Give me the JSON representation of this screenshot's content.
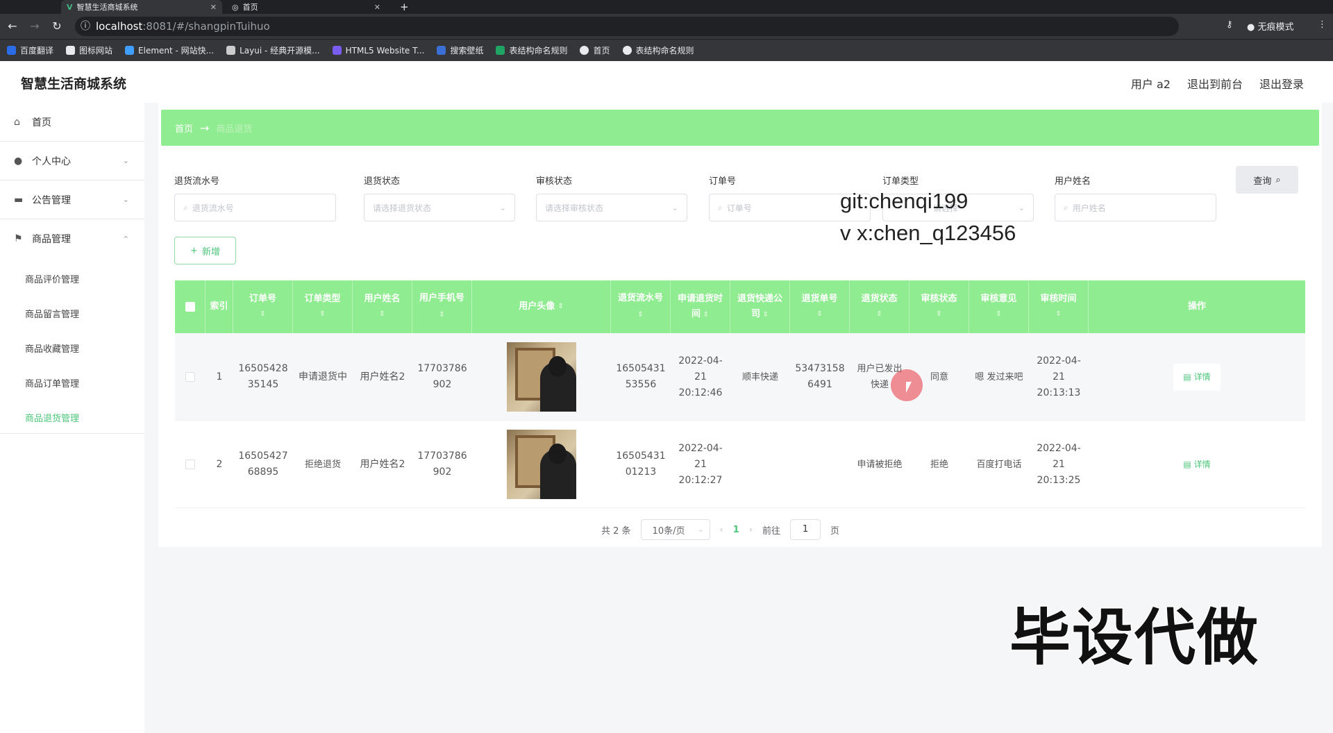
{
  "browser": {
    "tabs": [
      {
        "title": "智慧生活商城系统",
        "close": "✕"
      },
      {
        "title": "首页",
        "close": "✕"
      }
    ],
    "new_tab": "+",
    "url_host": "localhost",
    "url_path": ":8081/#/shangpinTuihuo",
    "profile": "无痕模式",
    "bookmarks": [
      "百度翻译",
      "图标网站",
      "Element - 网站快...",
      "Layui - 经典开源模...",
      "HTML5 Website T...",
      "搜索壁纸",
      "表结构命名规则",
      "首页",
      "表结构命名规则"
    ]
  },
  "app": {
    "brand": "智慧生活商城系统",
    "header_links": [
      "用户 a2",
      "退出到前台",
      "退出登录"
    ]
  },
  "sidebar": {
    "items": [
      {
        "label": "首页",
        "icon": "home-icon"
      },
      {
        "label": "个人中心",
        "icon": "user-icon"
      },
      {
        "label": "公告管理",
        "icon": "message-icon"
      },
      {
        "label": "商品管理",
        "icon": "flag-icon"
      }
    ],
    "sub_items": [
      "商品评价管理",
      "商品留言管理",
      "商品收藏管理",
      "商品订单管理",
      "商品退货管理"
    ]
  },
  "breadcrumb": {
    "home": "首页",
    "current": "商品退货"
  },
  "filters": [
    {
      "label": "退货流水号",
      "placeholder": "退货流水号"
    },
    {
      "label": "退货状态",
      "placeholder": "请选择退货状态"
    },
    {
      "label": "审核状态",
      "placeholder": "请选择审核状态"
    },
    {
      "label": "订单号",
      "placeholder": "订单号"
    },
    {
      "label": "订单类型",
      "placeholder": "请选择"
    },
    {
      "label": "用户姓名",
      "placeholder": "用户姓名"
    }
  ],
  "buttons": {
    "query": "查询",
    "add": "新增",
    "detail": "详情"
  },
  "table": {
    "columns": [
      "索引",
      "订单号",
      "订单类型",
      "用户姓名",
      "用户手机号",
      "用户头像",
      "退货流水号",
      "申请退货时间",
      "退货快递公司",
      "退货单号",
      "退货状态",
      "审核状态",
      "审核意见",
      "审核时间",
      "操作"
    ],
    "rows": [
      {
        "index": "1",
        "order_no": "1650542835145",
        "order_type": "申请退货中",
        "user_name": "用户姓名2",
        "phone": "17703786902",
        "return_no": "1650543153556",
        "apply_time": "2022-04-21 20:12:46",
        "courier": "顺丰快递",
        "tracking": "534731586491",
        "return_status": "用户已发出快递",
        "audit_status": "同意",
        "audit_opinion": "嗯 发过来吧",
        "audit_time": "2022-04-21 20:13:13"
      },
      {
        "index": "2",
        "order_no": "1650542768895",
        "order_type": "拒绝退货",
        "user_name": "用户姓名2",
        "phone": "17703786902",
        "return_no": "1650543101213",
        "apply_time": "2022-04-21 20:12:27",
        "courier": "",
        "tracking": "",
        "return_status": "申请被拒绝",
        "audit_status": "拒绝",
        "audit_opinion": "百度打电话",
        "audit_time": "2022-04-21 20:13:25"
      }
    ]
  },
  "pagination": {
    "total": "共 2 条",
    "page_size": "10条/页",
    "current": "1",
    "goto": "前往",
    "goto_value": "1",
    "page_unit": "页"
  },
  "watermarks": {
    "line1": "git:chenqi199",
    "line2": "v x:chen_q123456",
    "big": "毕设代做"
  },
  "colors": {
    "accent": "#90ec90",
    "link": "#4cc67a"
  }
}
